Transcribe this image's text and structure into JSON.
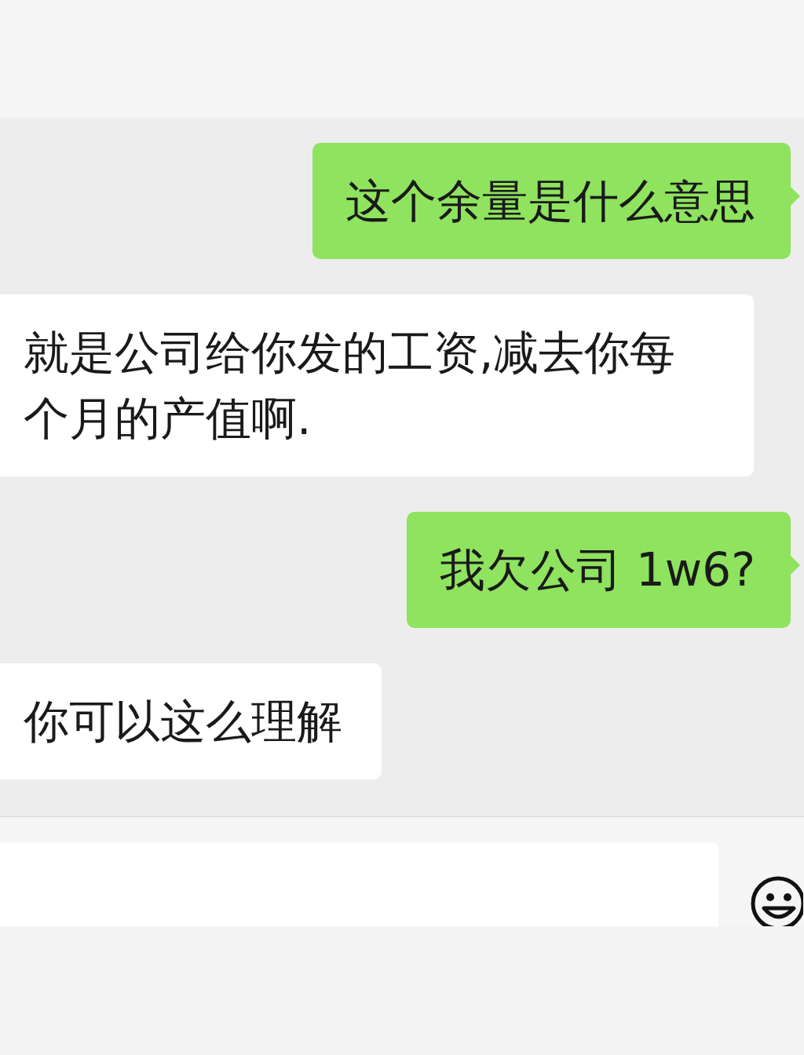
{
  "messages": [
    {
      "kind": "sent",
      "text": "这个余量是什么意思"
    },
    {
      "kind": "received",
      "text": "就是公司给你发的工资,减去你每个月的产值啊."
    },
    {
      "kind": "sent",
      "text": "我欠公司 1w6?"
    },
    {
      "kind": "received",
      "text": "你可以这么理解"
    }
  ]
}
